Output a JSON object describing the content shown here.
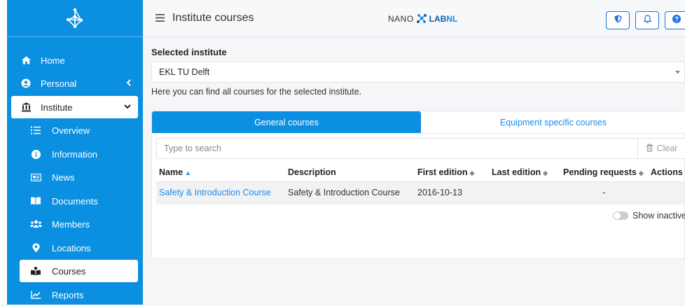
{
  "sidebar": {
    "items": [
      {
        "label": "Home",
        "icon": "home-icon"
      },
      {
        "label": "Personal",
        "icon": "user-circle-icon"
      },
      {
        "label": "Institute",
        "icon": "institution-icon"
      }
    ],
    "sub_items": [
      {
        "label": "Overview",
        "icon": "list-icon"
      },
      {
        "label": "Information",
        "icon": "info-icon"
      },
      {
        "label": "News",
        "icon": "newspaper-icon"
      },
      {
        "label": "Documents",
        "icon": "book-icon"
      },
      {
        "label": "Members",
        "icon": "users-icon"
      },
      {
        "label": "Locations",
        "icon": "map-marker-icon"
      },
      {
        "label": "Courses",
        "icon": "reader-icon"
      },
      {
        "label": "Reports",
        "icon": "chart-icon"
      }
    ]
  },
  "header": {
    "title": "Institute courses",
    "brand_part1": "NANO",
    "brand_part2": "LAB",
    "brand_part3": "NL"
  },
  "main": {
    "selected_label": "Selected institute",
    "selected_value": "EKL TU Delft",
    "help_text": "Here you can find all courses for the selected institute.",
    "tabs": [
      {
        "label": "General courses"
      },
      {
        "label": "Equipment specific courses"
      }
    ],
    "search_placeholder": "Type to search",
    "clear_label": "Clear",
    "columns": [
      "Name",
      "Description",
      "First edition",
      "Last edition",
      "Pending requests",
      "Actions"
    ],
    "rows": [
      {
        "name": "Safety & Introduction Course",
        "description": "Safety & Introduction Course",
        "first_edition": "2016-10-13",
        "last_edition": "",
        "pending": "-"
      }
    ],
    "show_inactive_label": "Show inactive"
  },
  "colors": {
    "accent": "#0b8fe0",
    "link": "#1c8be8"
  }
}
